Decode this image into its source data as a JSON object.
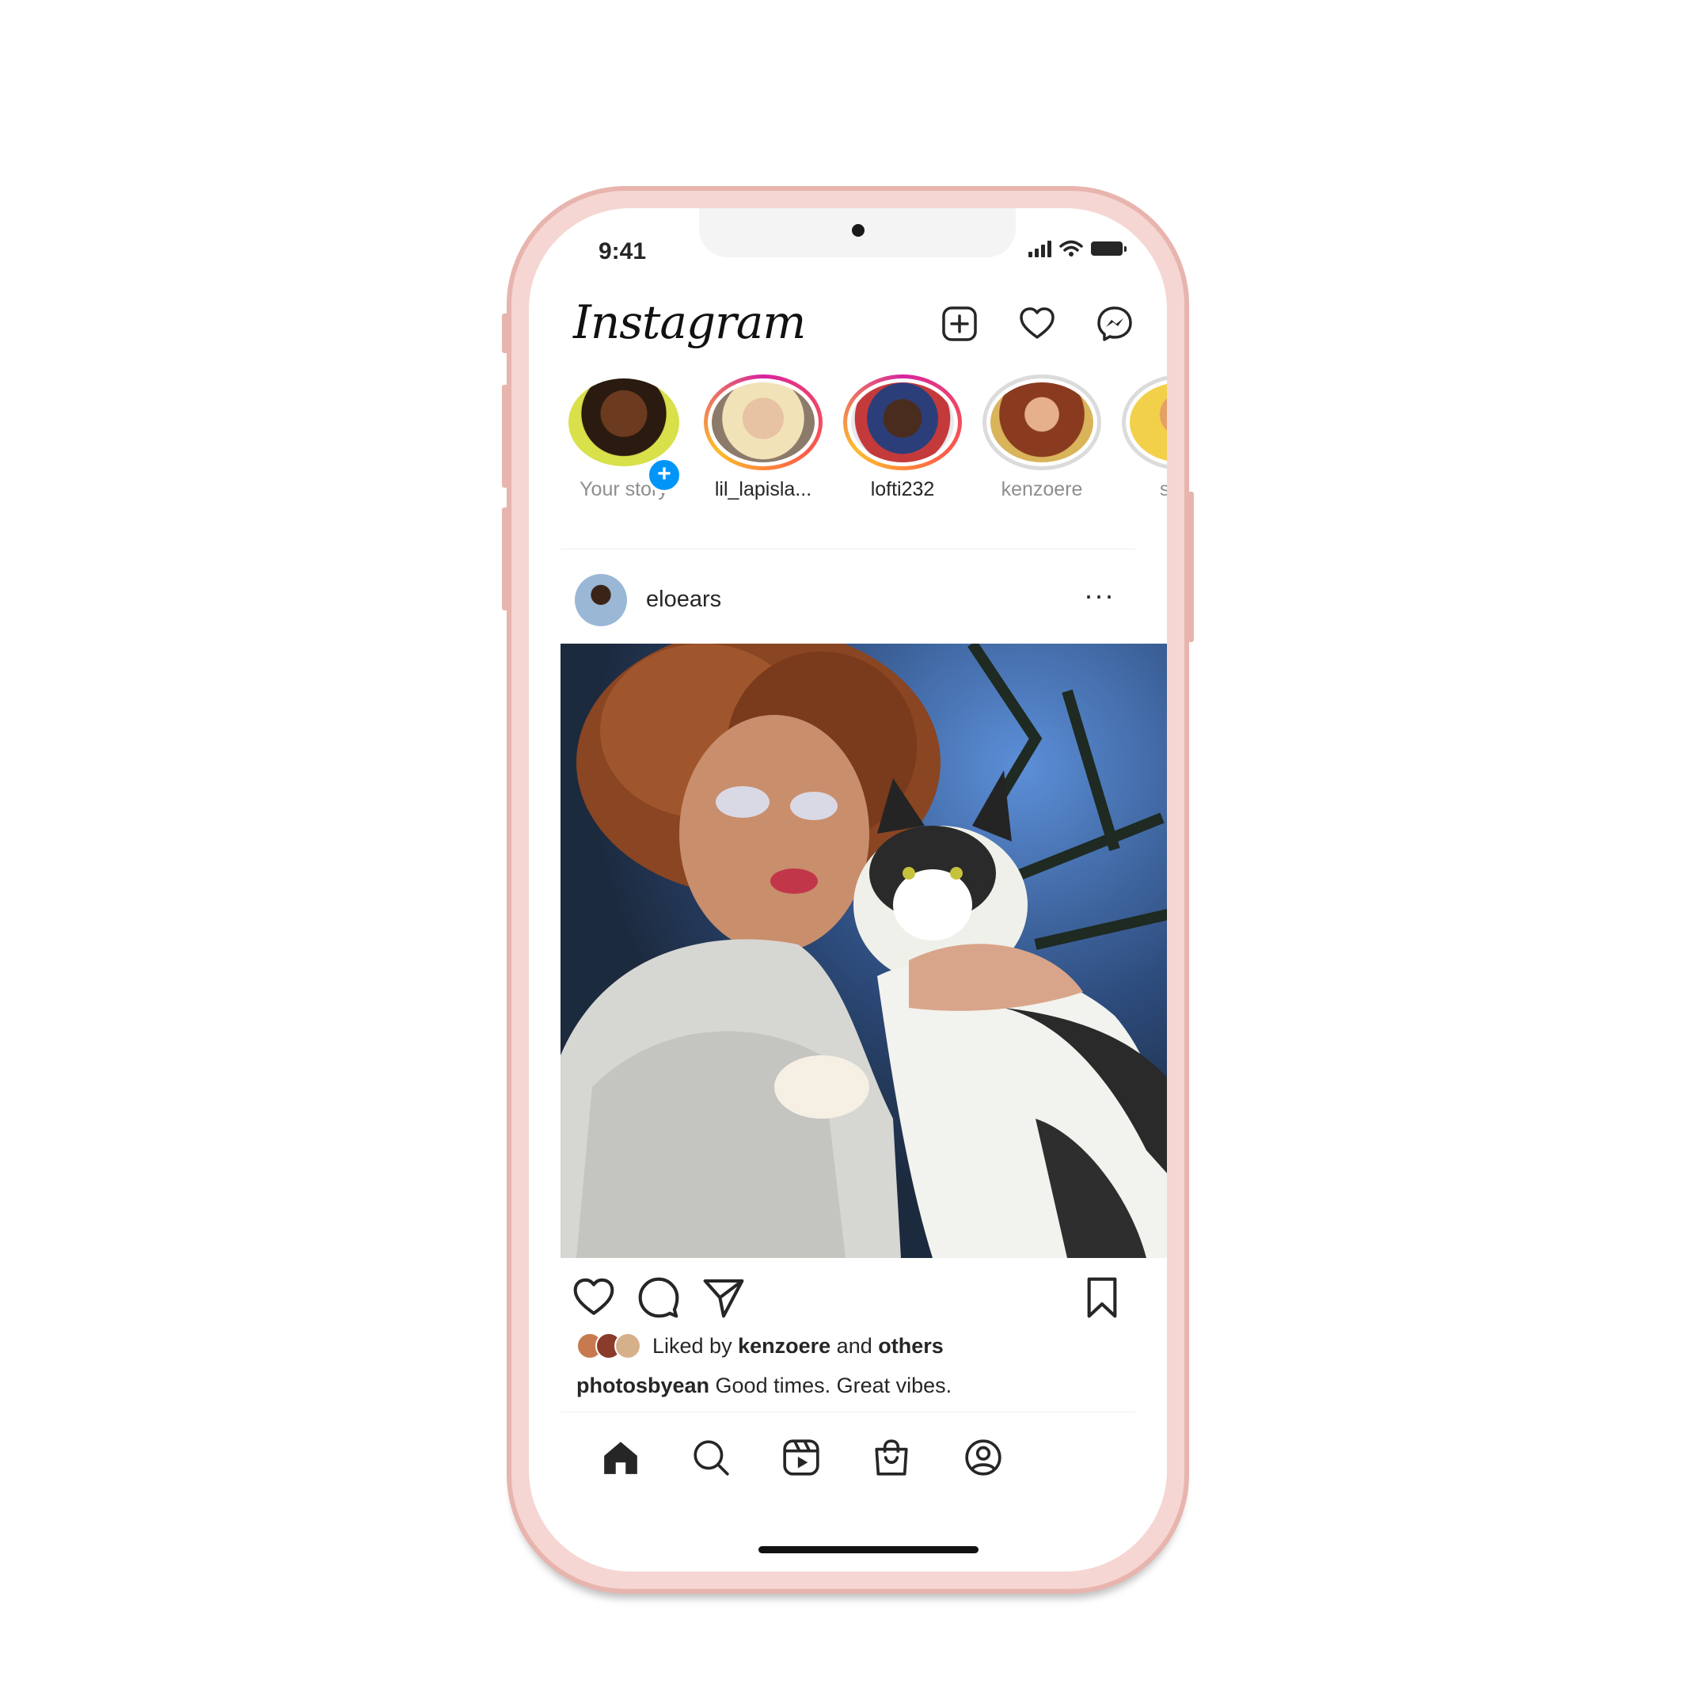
{
  "status_bar": {
    "time": "9:41"
  },
  "header": {
    "logo": "Instagram",
    "icons": [
      "new-post-icon",
      "heart-icon",
      "messenger-icon"
    ]
  },
  "stories": [
    {
      "label": "Your story",
      "ring": "none",
      "has_add_badge": true,
      "add_badge": "+"
    },
    {
      "label": "lil_lapisla...",
      "ring": "active"
    },
    {
      "label": "lofti232",
      "ring": "active"
    },
    {
      "label": "kenzoere",
      "ring": "seen"
    },
    {
      "label": "sapp",
      "ring": "seen"
    }
  ],
  "post": {
    "username": "eloears",
    "more": "···",
    "liked_prefix": "Liked by",
    "liked_user": "kenzoere",
    "liked_and": "and",
    "liked_others": "others",
    "caption_user": "photosbyean",
    "caption_text": "Good times. Great vibes.",
    "actions": [
      "like-icon",
      "comment-icon",
      "share-icon",
      "save-icon"
    ]
  },
  "tabbar": {
    "items": [
      "home-icon",
      "search-icon",
      "reels-icon",
      "shop-icon",
      "profile-icon"
    ],
    "active": "home-icon"
  },
  "colors": {
    "story_ring_start": "#d6249f",
    "story_ring_end": "#fdbb2d",
    "add_badge": "#0095f6",
    "phone_frame": "#e8b4ae"
  }
}
